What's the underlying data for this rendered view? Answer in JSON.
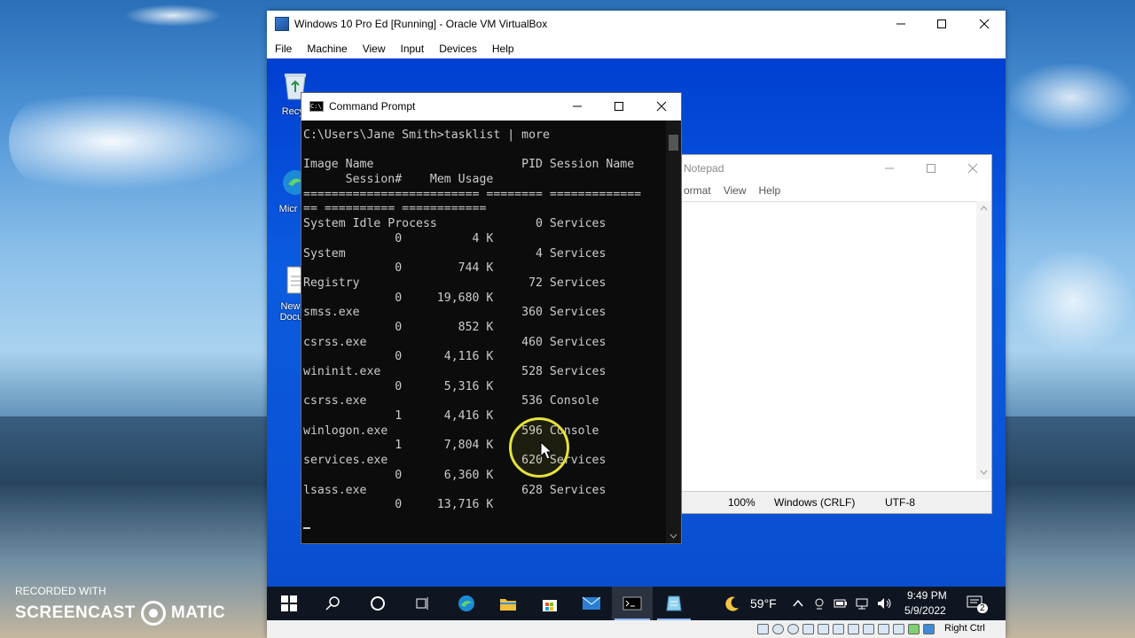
{
  "host": {
    "watermark_small": "RECORDED WITH",
    "watermark_left": "SCREENCAST",
    "watermark_right": "MATIC"
  },
  "vbox": {
    "title": "Windows 10 Pro Ed [Running] - Oracle VM VirtualBox",
    "menu": [
      "File",
      "Machine",
      "View",
      "Input",
      "Devices",
      "Help"
    ],
    "status_right": "Right Ctrl"
  },
  "desktop_icons": [
    {
      "label": "Recyc",
      "icon": "recycle-bin-icon"
    },
    {
      "label": "Micr Ec",
      "icon": "edge-icon"
    },
    {
      "label": "New R Docum",
      "icon": "document-icon"
    }
  ],
  "notepad": {
    "title": "Notepad",
    "menu": [
      "ormat",
      "View",
      "Help"
    ],
    "status": {
      "zoom": "100%",
      "line_endings": "Windows (CRLF)",
      "encoding": "UTF-8"
    }
  },
  "cmd": {
    "title": "Command Prompt",
    "lines": [
      "C:\\Users\\Jane Smith>tasklist | more",
      "",
      "Image Name                     PID Session Name",
      "      Session#    Mem Usage",
      "========================= ======== =============",
      "== ========== ============",
      "System Idle Process              0 Services",
      "             0          4 K",
      "System                           4 Services",
      "             0        744 K",
      "Registry                        72 Services",
      "             0     19,680 K",
      "smss.exe                       360 Services",
      "             0        852 K",
      "csrss.exe                      460 Services",
      "             0      4,116 K",
      "wininit.exe                    528 Services",
      "             0      5,316 K",
      "csrss.exe                      536 Console",
      "             1      4,416 K",
      "winlogon.exe                   596 Console",
      "             1      7,804 K",
      "services.exe                   620 Services",
      "             0      6,360 K",
      "lsass.exe                      628 Services",
      "             0     13,716 K"
    ]
  },
  "taskbar": {
    "weather": "59°F",
    "time": "9:49 PM",
    "date": "5/9/2022",
    "notifications": "2"
  }
}
